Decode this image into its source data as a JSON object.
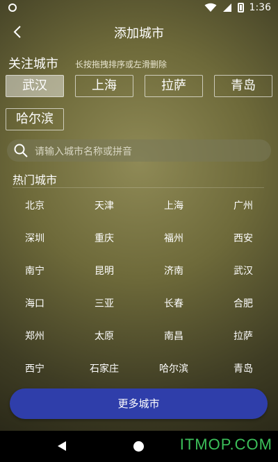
{
  "status": {
    "time": "1:36"
  },
  "appbar": {
    "title": "添加城市"
  },
  "followed": {
    "title": "关注城市",
    "hint": "长按拖拽排序或左滑删除",
    "cities": [
      "武汉",
      "上海",
      "拉萨",
      "青岛",
      "哈尔滨"
    ]
  },
  "search": {
    "placeholder": "请输入城市名称或拼音"
  },
  "hot": {
    "title": "热门城市",
    "cities": [
      "北京",
      "天津",
      "上海",
      "广州",
      "深圳",
      "重庆",
      "福州",
      "西安",
      "南宁",
      "昆明",
      "济南",
      "武汉",
      "海口",
      "三亚",
      "长春",
      "合肥",
      "郑州",
      "太原",
      "南昌",
      "拉萨",
      "西宁",
      "石家庄",
      "哈尔滨",
      "青岛"
    ]
  },
  "more_button": "更多城市",
  "watermark": "ITMOP.COM",
  "colors": {
    "accent": "#2f3eaa",
    "watermark": "#3cc15a"
  }
}
